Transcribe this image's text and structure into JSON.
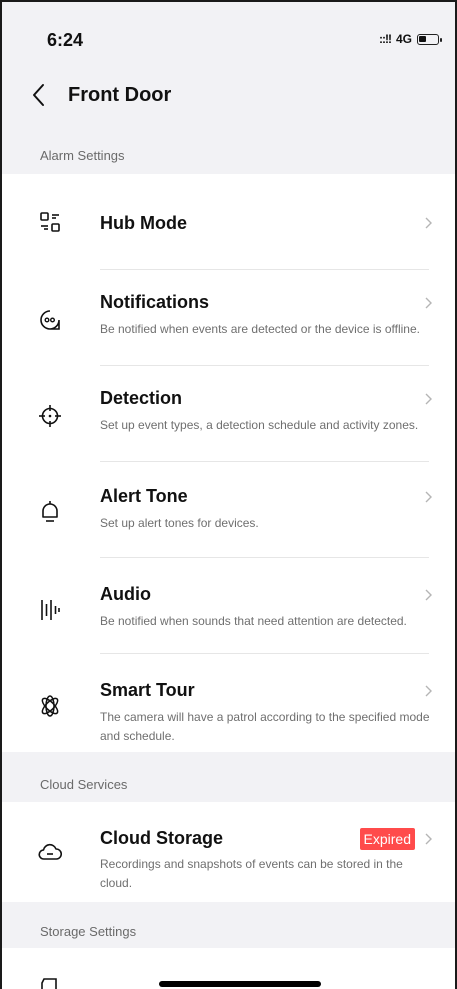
{
  "status": {
    "time": "6:24",
    "signal": "::!!",
    "network": "4G"
  },
  "nav": {
    "title": "Front Door"
  },
  "sections": {
    "alarm": "Alarm Settings",
    "cloud": "Cloud Services",
    "storage": "Storage Settings"
  },
  "alarm_items": [
    {
      "title": "Hub Mode",
      "desc": "",
      "icon": "hub-mode-icon"
    },
    {
      "title": "Notifications",
      "desc": "Be notified when events are detected or the device is offline.",
      "icon": "notification-icon"
    },
    {
      "title": "Detection",
      "desc": "Set up event types, a detection schedule and activity zones.",
      "icon": "crosshair-icon"
    },
    {
      "title": "Alert Tone",
      "desc": "Set up alert tones for devices.",
      "icon": "bell-icon"
    },
    {
      "title": "Audio",
      "desc": "Be notified when sounds that need attention are detected.",
      "icon": "audio-wave-icon"
    },
    {
      "title": "Smart Tour",
      "desc": "The camera will have a patrol according to the specified mode and schedule.",
      "icon": "atom-icon"
    }
  ],
  "cloud_items": [
    {
      "title": "Cloud Storage",
      "desc": "Recordings and snapshots of events can be stored in the cloud.",
      "badge": "Expired",
      "icon": "cloud-icon"
    }
  ],
  "colors": {
    "badge": "#ff4b4b",
    "background": "#f2f2f5"
  }
}
